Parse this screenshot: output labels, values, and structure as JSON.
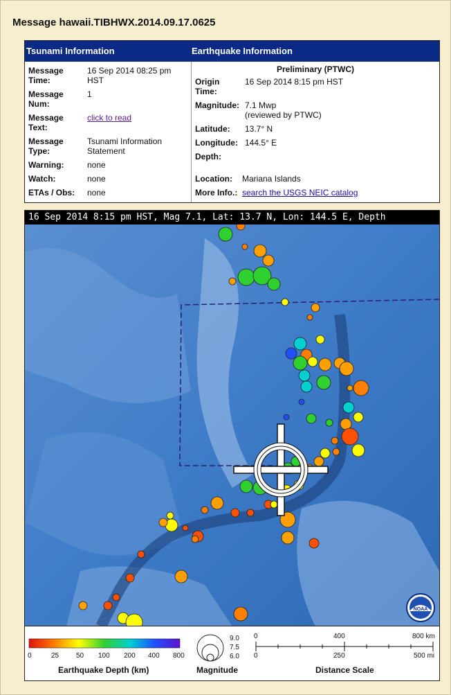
{
  "title": "Message hawaii.TIBHWX.2014.09.17.0625",
  "tsunami": {
    "header": "Tsunami Information",
    "rows": [
      {
        "label": "Message Time:",
        "value": "16 Sep 2014 08:25 pm HST"
      },
      {
        "label": "Message Num:",
        "value": "1"
      },
      {
        "label": "Message Text:",
        "value": "click to read"
      },
      {
        "label": "Message Type:",
        "value": "Tsunami Information Statement"
      },
      {
        "label": "Warning:",
        "value": "none"
      },
      {
        "label": "Watch:",
        "value": "none"
      },
      {
        "label": "ETAs / Obs:",
        "value": "none"
      }
    ]
  },
  "earthquake": {
    "header": "Earthquake Information",
    "status": "Preliminary (PTWC)",
    "rows": [
      {
        "label": "Origin Time:",
        "value": "16 Sep 2014 8:15 pm HST"
      },
      {
        "label": "Magnitude:",
        "value": "7.1 Mwp",
        "note": "(reviewed by PTWC)"
      },
      {
        "label": "Latitude:",
        "value": "13.7° N"
      },
      {
        "label": "Longitude:",
        "value": "144.5° E"
      },
      {
        "label": "Depth:",
        "value": ""
      },
      {
        "label": "Location:",
        "value": "Mariana Islands"
      },
      {
        "label": "More Info.:",
        "value": "search the USGS NEIC catalog"
      }
    ]
  },
  "map": {
    "caption": "16 Sep 2014 8:15 pm HST, Mag 7.1, Lat: 13.7 N, Lon: 144.5 E, Depth",
    "logo_text": "NOAA"
  },
  "legend": {
    "depth_title": "Earthquake Depth (km)",
    "depth_ticks": [
      "0",
      "25",
      "50",
      "100",
      "200",
      "400",
      "800"
    ],
    "mag_title": "Magnitude",
    "mag_values": [
      "9.0",
      "7.5",
      "6.0"
    ],
    "scale_title": "Distance Scale",
    "km_ticks": [
      "0",
      "400",
      "800 km"
    ],
    "mi_ticks": [
      "0",
      "250",
      "500 mi"
    ]
  },
  "colors": {
    "header_bg": "#0b2a85",
    "page_bg": "#f6eecf",
    "ocean": "#2a6cb5"
  }
}
